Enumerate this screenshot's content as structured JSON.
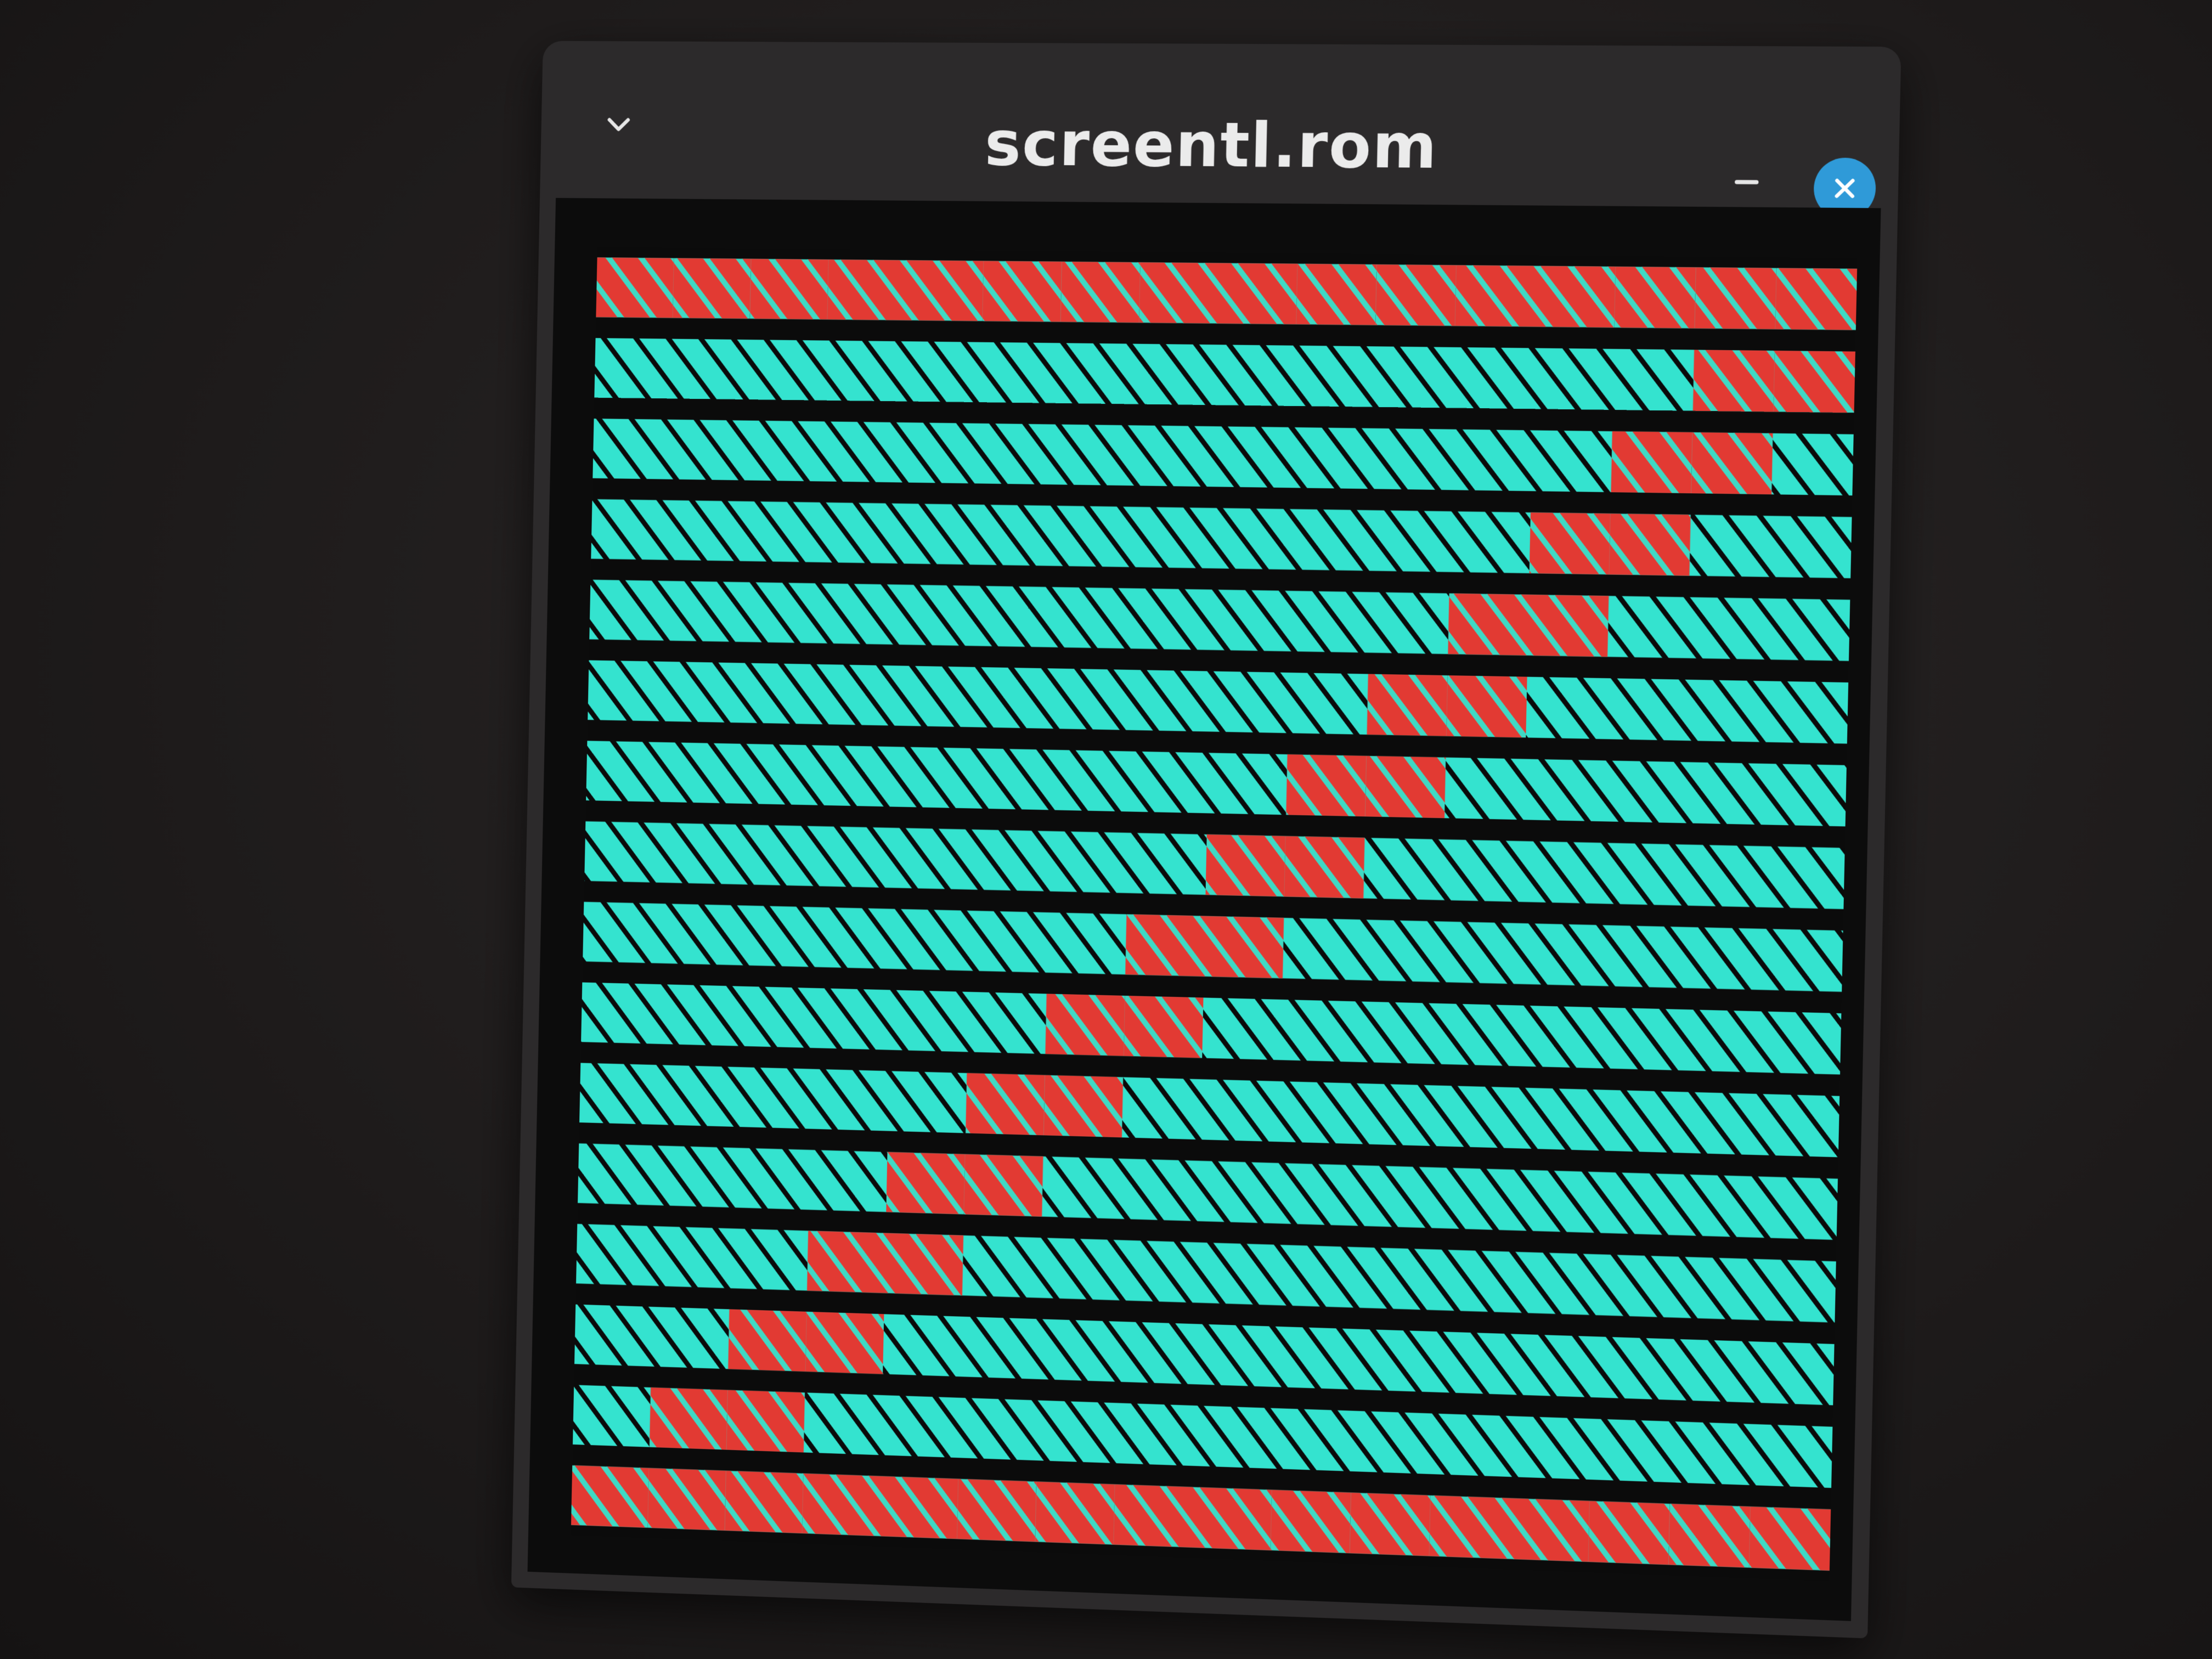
{
  "window": {
    "title": "screentl.rom",
    "menu_icon": "chevron-down-icon",
    "minimize_icon": "minimize-icon",
    "close_icon": "close-icon"
  },
  "display": {
    "tile_rows": 16,
    "tile_cols": 16,
    "colors": {
      "background": "#0b0b0b",
      "tile": "#34e3cf",
      "highlight": "#e23a33",
      "stripe": "#0a0a0a",
      "close_button": "#2f9ad8"
    }
  }
}
